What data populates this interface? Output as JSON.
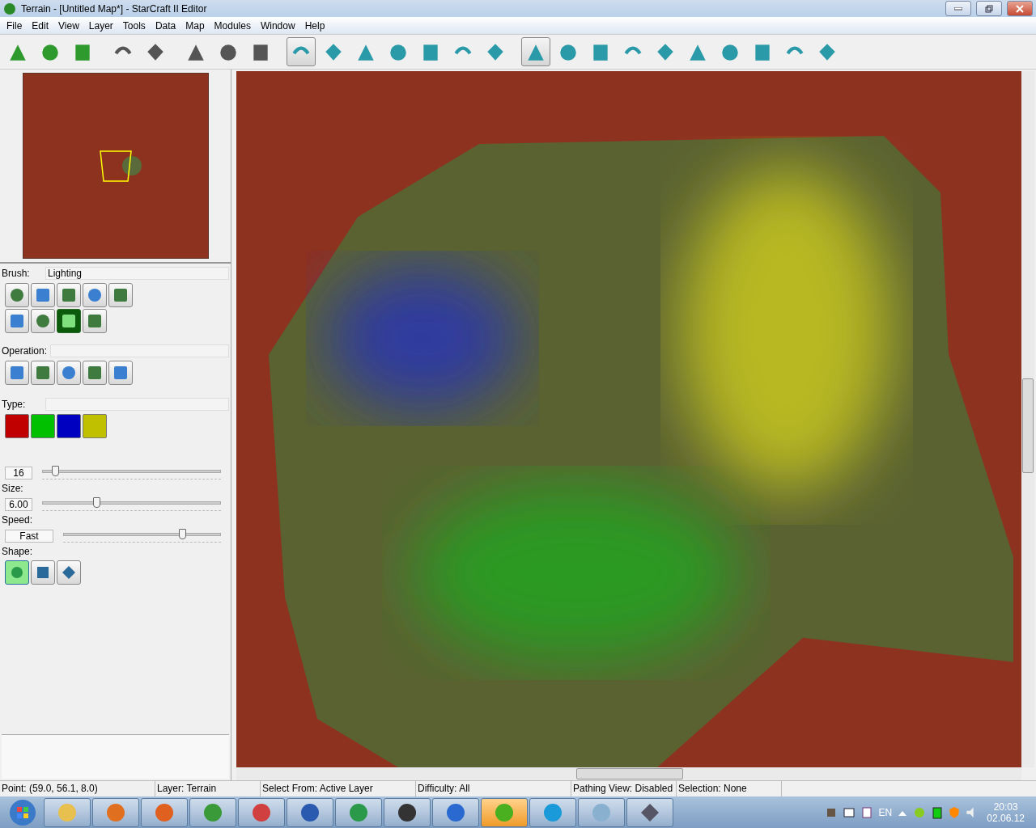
{
  "window": {
    "title": "Terrain - [Untitled Map*] - StarCraft II Editor"
  },
  "menu": [
    "File",
    "Edit",
    "View",
    "Layer",
    "Tools",
    "Data",
    "Map",
    "Modules",
    "Window",
    "Help"
  ],
  "toolbar": [
    {
      "selected": false
    },
    {
      "selected": false
    },
    {
      "selected": false
    },
    {
      "selected": false
    },
    {
      "selected": false
    },
    {
      "selected": false
    },
    {
      "selected": false
    },
    {
      "selected": false
    },
    {
      "selected": true
    },
    {
      "selected": false
    },
    {
      "selected": false
    },
    {
      "selected": false
    },
    {
      "selected": false
    },
    {
      "selected": false
    },
    {
      "selected": false
    },
    {
      "selected": true
    },
    {
      "selected": false
    },
    {
      "selected": false
    },
    {
      "selected": false
    },
    {
      "selected": false
    },
    {
      "selected": false
    },
    {
      "selected": false
    },
    {
      "selected": false
    },
    {
      "selected": false
    },
    {
      "selected": false
    }
  ],
  "brush": {
    "label": "Brush:",
    "value": "Lighting",
    "items": [
      {
        "selected": false
      },
      {
        "selected": false
      },
      {
        "selected": false
      },
      {
        "selected": false
      },
      {
        "selected": false
      },
      {
        "selected": false
      },
      {
        "selected": false
      },
      {
        "selected": true
      },
      {
        "selected": false
      }
    ]
  },
  "operation": {
    "label": "Operation:",
    "items": [
      {
        "selected": false
      },
      {
        "selected": false
      },
      {
        "selected": false
      },
      {
        "selected": false
      },
      {
        "selected": false
      }
    ]
  },
  "type": {
    "label": "Type:",
    "items": [
      {
        "color": "#c00000"
      },
      {
        "color": "#00c000"
      },
      {
        "color": "#0000c0"
      },
      {
        "color": "#c0c000"
      }
    ]
  },
  "sliders": [
    {
      "value": "16",
      "level": 0.07,
      "wide": false
    },
    {
      "label": "Size:",
      "value": "6.00",
      "level": 0.3,
      "wide": false
    },
    {
      "label": "Speed:",
      "value": "Fast",
      "level": 0.75,
      "wide": true
    }
  ],
  "shape": {
    "label": "Shape:",
    "items": [
      {
        "selected": true
      },
      {
        "selected": false
      },
      {
        "selected": false
      }
    ]
  },
  "status_bar": [
    "Point: (59.0, 56.1, 8.0)",
    "Layer: Terrain",
    "Select From: Active Layer",
    "Difficulty: All",
    "Pathing View: Disabled",
    "Selection: None"
  ],
  "taskbar": {
    "apps": [
      {
        "selected": false
      },
      {
        "selected": false
      },
      {
        "selected": false
      },
      {
        "selected": false
      },
      {
        "selected": false
      },
      {
        "selected": false
      },
      {
        "selected": false
      },
      {
        "selected": false
      },
      {
        "selected": false
      },
      {
        "selected": true
      },
      {
        "selected": false
      },
      {
        "selected": false
      }
    ],
    "language": "EN",
    "time": "20:03",
    "date": "02.06.12"
  }
}
